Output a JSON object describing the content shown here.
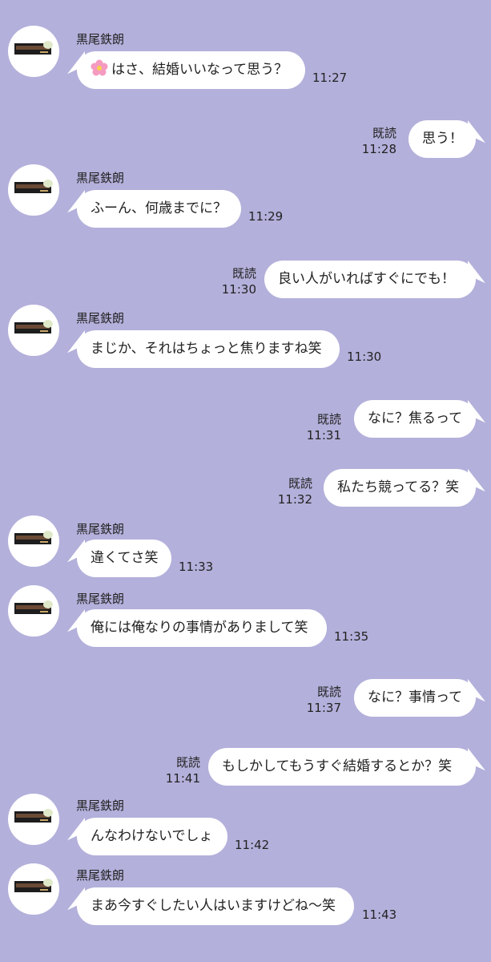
{
  "chat": {
    "messages": [
      {
        "direction": "in",
        "sender": "黒尾鉄朗",
        "text": "はさ、結婚いいなって思う？",
        "time": "11:27",
        "has_flower_icon": true
      },
      {
        "direction": "out",
        "read": "既読",
        "text": "思う！",
        "time": "11:28"
      },
      {
        "direction": "in",
        "sender": "黒尾鉄朗",
        "text": "ふーん、何歳までに？",
        "time": "11:29"
      },
      {
        "direction": "out",
        "read": "既読",
        "text": "良い人がいればすぐにでも！",
        "time": "11:30"
      },
      {
        "direction": "in",
        "sender": "黒尾鉄朗",
        "text": "まじか、それはちょっと焦りますね笑",
        "time": "11:30"
      },
      {
        "direction": "out",
        "read": "既読",
        "text": "なに？焦るって",
        "time": "11:31"
      },
      {
        "direction": "out",
        "read": "既読",
        "text": "私たち競ってる？笑",
        "time": "11:32"
      },
      {
        "direction": "in",
        "sender": "黒尾鉄朗",
        "text": "違くてさ笑",
        "time": "11:33"
      },
      {
        "direction": "in",
        "sender": "黒尾鉄朗",
        "text": "俺には俺なりの事情がありまして笑",
        "time": "11:35"
      },
      {
        "direction": "out",
        "read": "既読",
        "text": "なに？事情って",
        "time": "11:37"
      },
      {
        "direction": "out",
        "read": "既読",
        "text": "もしかしてもうすぐ結婚するとか？笑",
        "time": "11:41"
      },
      {
        "direction": "in",
        "sender": "黒尾鉄朗",
        "text": "んなわけないでしょ",
        "time": "11:42"
      },
      {
        "direction": "in",
        "sender": "黒尾鉄朗",
        "text": "まあ今すぐしたい人はいますけどね〜笑",
        "time": "11:43"
      }
    ]
  },
  "colors": {
    "background": "#b3b0db",
    "bubble": "#ffffff",
    "text": "#222222"
  },
  "icons": {
    "avatar": "grilled-fish-avatar-icon",
    "emoji": "cherry-blossom-icon"
  }
}
